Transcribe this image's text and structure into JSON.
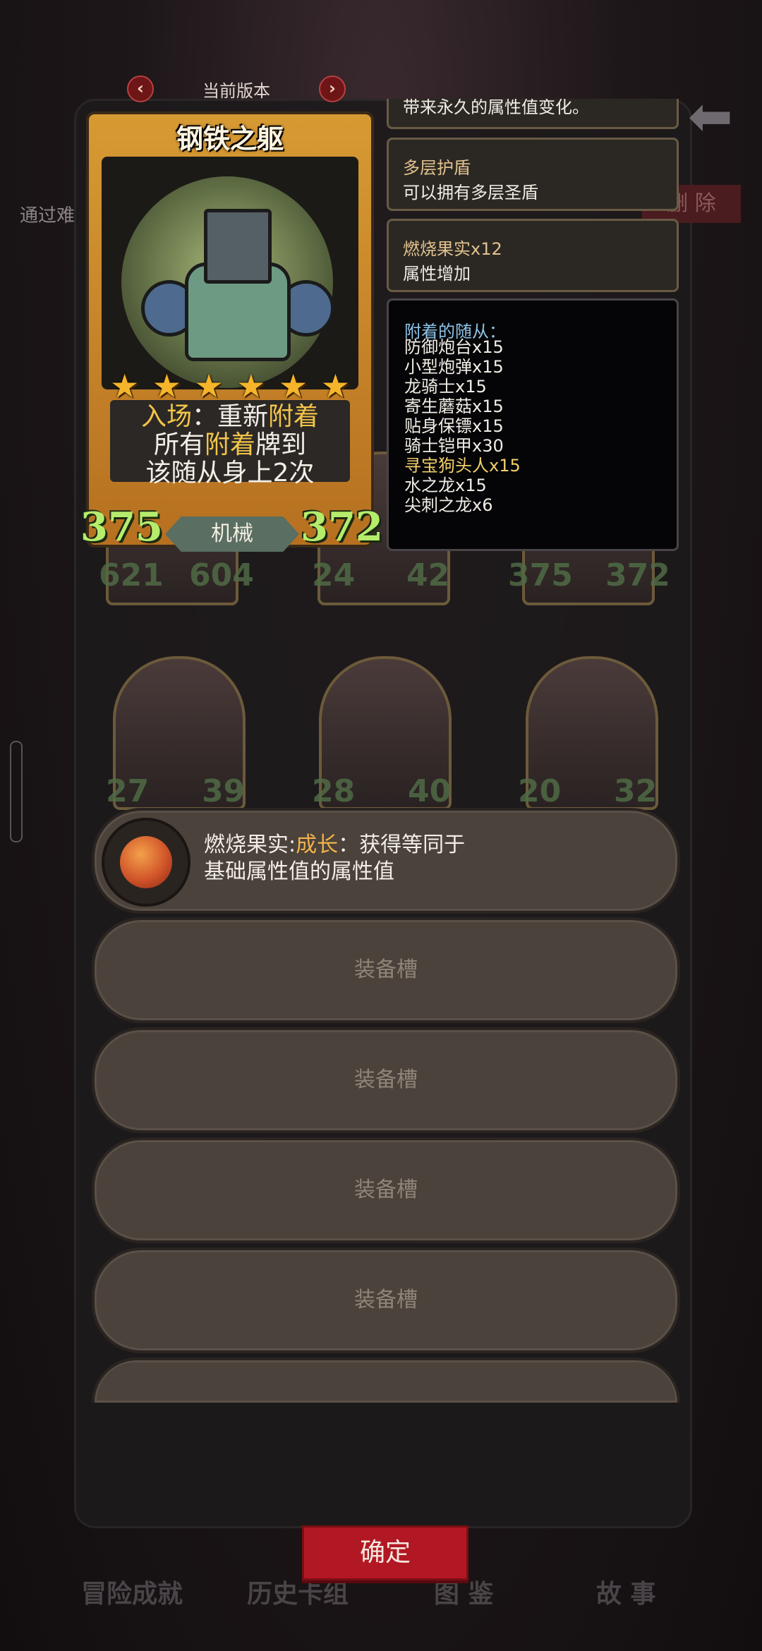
{
  "background": {
    "left_text": "通过难",
    "delete_label": "删 除"
  },
  "card_header": {
    "version_label": "当前版本"
  },
  "card": {
    "name": "钢铁之躯",
    "star_count": 6,
    "desc_line1_a": "入场",
    "desc_line1_b": "：重新",
    "desc_line1_c": "附着",
    "desc_line2_a": "所有",
    "desc_line2_b": "附着",
    "desc_line2_c": "牌到",
    "desc_line3": "该随从身上2次",
    "attack": "375",
    "health": "372",
    "tribe": "机械"
  },
  "info_panels": {
    "truncated_text": "带来永久的属性值变化。",
    "multi_shield_title": "多层护盾",
    "multi_shield_body": "可以拥有多层圣盾",
    "fruit_title": "燃烧果实x12",
    "fruit_body": "属性增加"
  },
  "followers": {
    "title": "附着的随从：",
    "items": [
      {
        "name": "防御炮台x15",
        "highlight": false
      },
      {
        "name": "小型炮弹x15",
        "highlight": false
      },
      {
        "name": "龙骑士x15",
        "highlight": false
      },
      {
        "name": "寄生蘑菇x15",
        "highlight": false
      },
      {
        "name": "贴身保镖x15",
        "highlight": false
      },
      {
        "name": "骑士铠甲x30",
        "highlight": false
      },
      {
        "name": "寻宝狗头人x15",
        "highlight": true
      },
      {
        "name": "水之龙x15",
        "highlight": false
      },
      {
        "name": "尖刺之龙x6",
        "highlight": false
      }
    ]
  },
  "grid_stats": {
    "row1": [
      [
        "621",
        "604"
      ],
      [
        "24",
        "42"
      ],
      [
        "375",
        "372"
      ]
    ],
    "row2": [
      [
        "27",
        "39"
      ],
      [
        "28",
        "40"
      ],
      [
        "20",
        "32"
      ]
    ]
  },
  "slots": {
    "first_prefix": "燃烧果实:",
    "first_keyword": "成长",
    "first_rest": "：获得等同于",
    "first_line2": "基础属性值的属性值",
    "empty_label": "装备槽"
  },
  "bottom_nav": {
    "items": [
      "冒险成就",
      "历史卡组",
      "图 鉴",
      "故 事"
    ],
    "confirm": "确定"
  }
}
